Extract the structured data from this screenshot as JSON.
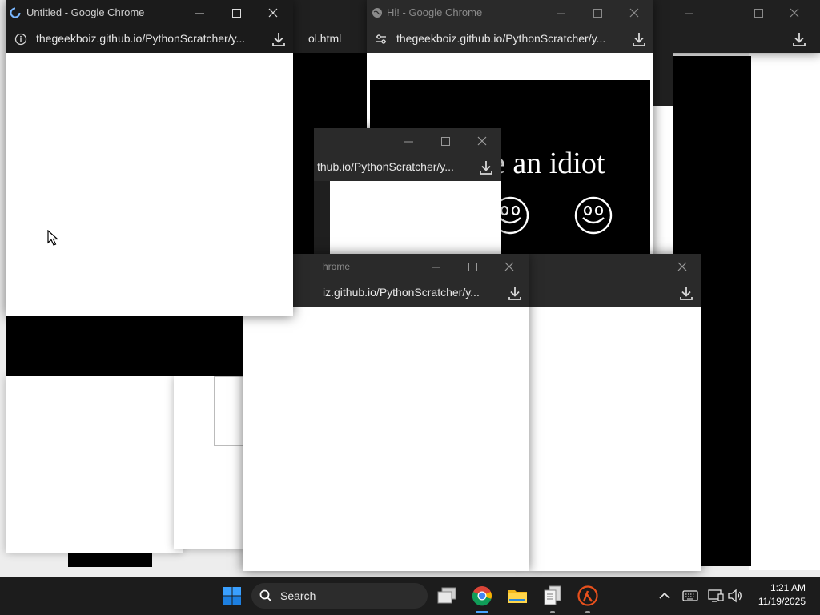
{
  "windows": {
    "untitled": {
      "title": "Untitled - Google Chrome",
      "url": "thegeekboiz.github.io/PythonScratcher/y..."
    },
    "hi": {
      "title": "Hi! - Google Chrome",
      "url": "thegeekboiz.github.io/PythonScratcher/y...",
      "banner_text": "e an idiot"
    },
    "middle": {
      "url": "thub.io/PythonScratcher/y..."
    },
    "lower": {
      "title": "hrome",
      "url": "iz.github.io/PythonScratcher/y..."
    },
    "back": {
      "url": "ol.html"
    }
  },
  "taskbar": {
    "search_label": "Search",
    "time": "1:21 AM",
    "date": "11/19/2025",
    "accent": "#0078d4",
    "apps": [
      "windows-start-icon",
      "task-view-icon",
      "chrome-icon",
      "file-explorer-icon",
      "notepad-icon",
      "half-life-icon"
    ]
  },
  "colors": {
    "chrome_bar": "#202020",
    "window_bg": "#ffffff",
    "banner_bg": "#000000"
  }
}
